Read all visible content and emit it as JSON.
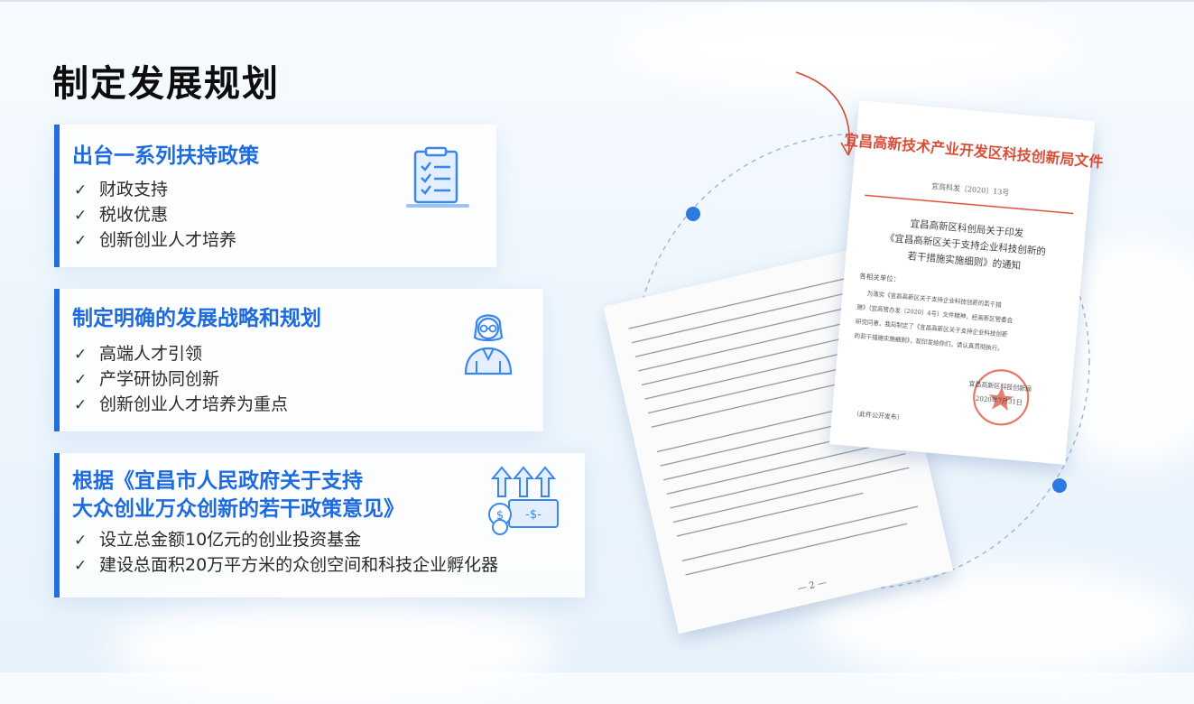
{
  "page": {
    "title": "制定发展规划"
  },
  "cards": [
    {
      "title_lines": [
        "出台一系列扶持政策"
      ],
      "items": [
        "财政支持",
        "税收优惠",
        "创新创业人才培养"
      ],
      "icon": "document-checklist-icon"
    },
    {
      "title_lines": [
        "制定明确的发展战略和规划"
      ],
      "items": [
        "高端人才引领",
        "产学研协同创新",
        "创新创业人才培养为重点"
      ],
      "icon": "professional-person-icon"
    },
    {
      "title_lines": [
        "根据《宜昌市人民政府关于支持",
        "大众创业万众创新的若干政策意见》"
      ],
      "items": [
        "设立总金额10亿元的创业投资基金",
        "建设总面积20万平方米的众创空间和科技企业孵化器"
      ],
      "icon": "money-growth-icon"
    }
  ],
  "check_symbol": "✓",
  "documents": {
    "front": {
      "header": "宜昌高新技术产业开发区科技创新局文件",
      "doc_number": "宜高科发〔2020〕13号",
      "title_lines": [
        "宜昌高新区科创局关于印发",
        "《宜昌高新区关于支持企业科技创新的",
        "若干措施实施细则》的通知"
      ],
      "salutation": "各相关单位：",
      "body_lines": [
        "为落实《宜昌高新区关于支持企业科技创新的若干措",
        "施》（宜高管办发〔2020〕4号）文件精神，经高新区管委会",
        "研究同意，我局制定了《宜昌高新区关于支持企业科技创新",
        "的若干措施实施细则》，现印发给你们，请认真贯彻执行。"
      ],
      "signature": "宜昌高新区科技创新局",
      "date": "2020年7月31日",
      "footer_note": "（此件公开发布）"
    },
    "back": {
      "page_number": "— 2 —"
    }
  },
  "colors": {
    "accent": "#1e6be0",
    "bar": "#1f6fe0",
    "doc_red": "#d9472f",
    "dot": "#2a7ae2"
  }
}
